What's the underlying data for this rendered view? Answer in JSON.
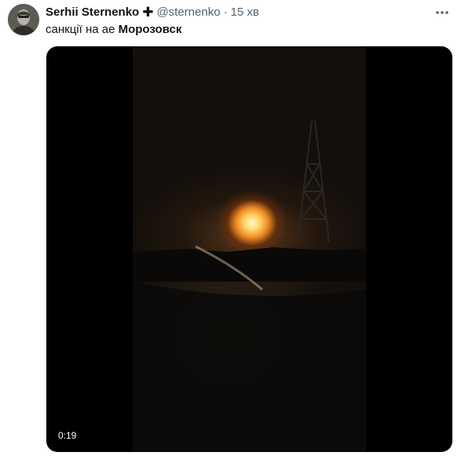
{
  "author": {
    "name": "Serhii Sternenko",
    "badge": "✚",
    "handle": "@sternenko",
    "separator": "·",
    "time": "15 хв"
  },
  "tweet": {
    "text_plain": "санкції на ае ",
    "text_bold": "Морозовск"
  },
  "media": {
    "type": "video",
    "duration": "0:19"
  },
  "icons": {
    "more": "more-horizontal-icon"
  },
  "colors": {
    "text_primary": "#0f1419",
    "text_secondary": "#536471",
    "media_background": "#000000"
  }
}
